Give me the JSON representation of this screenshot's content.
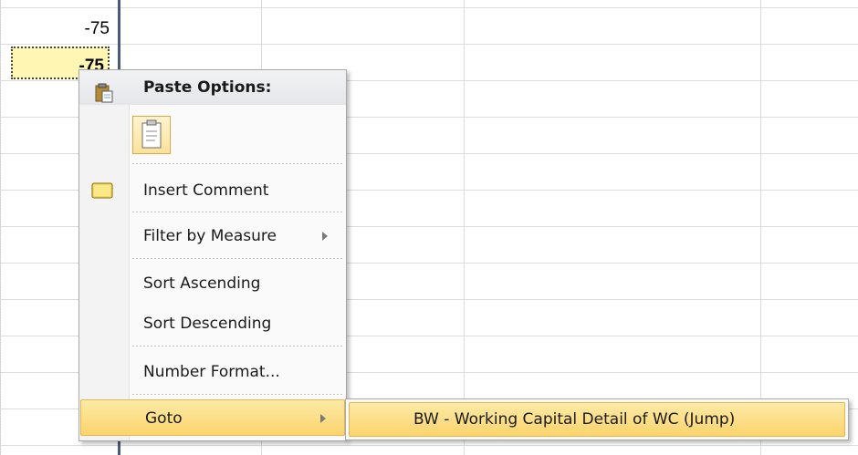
{
  "sheet": {
    "cells": [
      {
        "value": "-75",
        "selected": false
      },
      {
        "value": "-75",
        "selected": true
      }
    ],
    "selected_fill": "#fff6b4"
  },
  "context_menu": {
    "header": "Paste Options:",
    "paste_icon": "clipboard-icon",
    "items": [
      {
        "label": "Insert Comment",
        "icon": "comment-icon",
        "has_submenu": false
      },
      {
        "label": "Filter by Measure",
        "has_submenu": true
      },
      {
        "label": "Sort Ascending",
        "has_submenu": false
      },
      {
        "label": "Sort Descending",
        "has_submenu": false
      },
      {
        "label": "Number Format...",
        "has_submenu": false
      },
      {
        "label": "Goto",
        "has_submenu": true,
        "highlighted": true
      }
    ],
    "highlight_color": "#fbd46c"
  },
  "submenu": {
    "items": [
      {
        "label": "BW - Working Capital Detail of WC (Jump)",
        "highlighted": true
      }
    ]
  }
}
